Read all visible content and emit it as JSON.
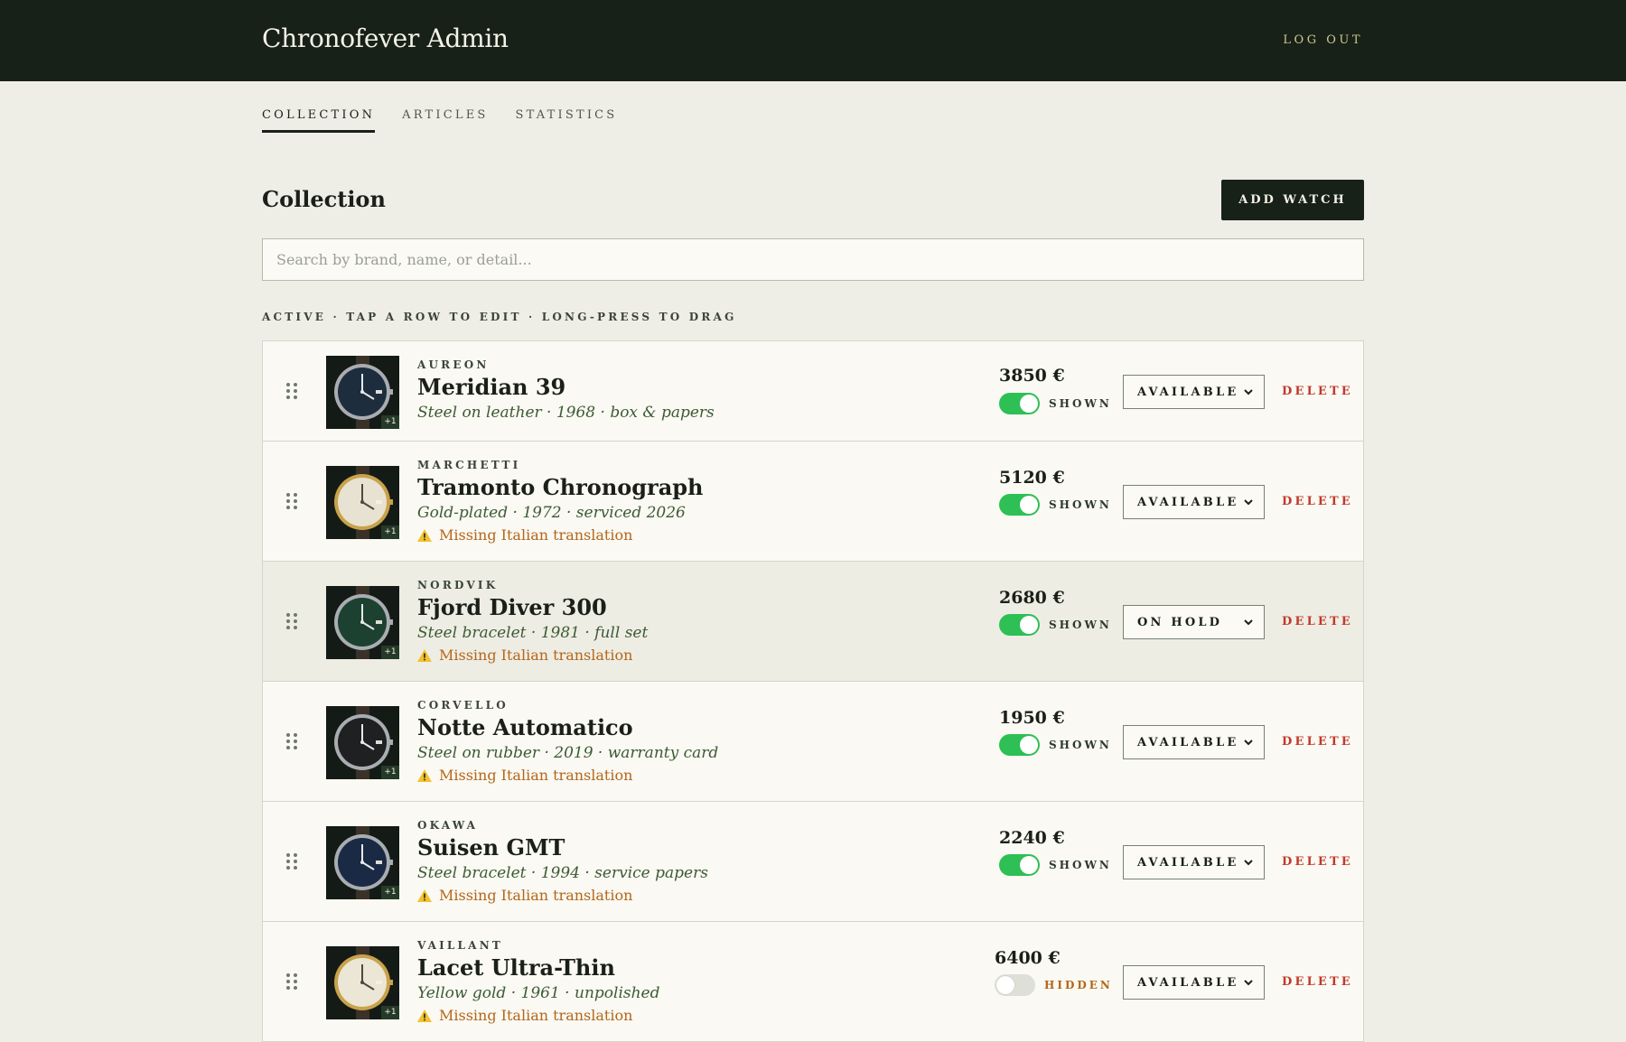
{
  "header": {
    "title": "Chronofever Admin",
    "logout_label": "LOG OUT"
  },
  "tabs": [
    {
      "label": "COLLECTION",
      "active": true
    },
    {
      "label": "ARTICLES",
      "active": false
    },
    {
      "label": "STATISTICS",
      "active": false
    }
  ],
  "main": {
    "title": "Collection",
    "add_label": "ADD WATCH",
    "search_placeholder": "Search by brand, name, or detail...",
    "hint": "ACTIVE · TAP A ROW TO EDIT · LONG-PRESS TO DRAG"
  },
  "colors": {
    "accent_dark": "#172117",
    "toggle_on": "#2ebf55",
    "warning": "#b4661a",
    "delete": "#c0392b"
  },
  "icons": {
    "drag": "drag-handle-icon",
    "warning": "warning-icon",
    "chevron": "chevron-down-icon",
    "watch": "watch-thumbnail-icon"
  },
  "watches": [
    {
      "brand": "AUREON",
      "name": "Meridian 39",
      "detail": "Steel on leather · 1968 · box & papers",
      "warning": "",
      "price": "3850 €",
      "visibility": "SHOWN",
      "visible": true,
      "status": "AVAILABLE",
      "delete_label": "DELETE",
      "thumb_badge": "+1",
      "dial": "#1e2d3e"
    },
    {
      "brand": "MARCHETTI",
      "name": "Tramonto Chronograph",
      "detail": "Gold-plated · 1972 · serviced 2026",
      "warning": "Missing Italian translation",
      "price": "5120 €",
      "visibility": "SHOWN",
      "visible": true,
      "status": "AVAILABLE",
      "delete_label": "DELETE",
      "thumb_badge": "+1",
      "dial": "#e8e2d2"
    },
    {
      "brand": "NORDVIK",
      "name": "Fjord Diver 300",
      "detail": "Steel bracelet · 1981 · full set",
      "warning": "Missing Italian translation",
      "price": "2680 €",
      "visibility": "SHOWN",
      "visible": true,
      "status": "ON HOLD",
      "delete_label": "DELETE",
      "thumb_badge": "+1",
      "dial": "#1d4130"
    },
    {
      "brand": "CORVELLO",
      "name": "Notte Automatico",
      "detail": "Steel on rubber · 2019 · warranty card",
      "warning": "Missing Italian translation",
      "price": "1950 €",
      "visibility": "SHOWN",
      "visible": true,
      "status": "AVAILABLE",
      "delete_label": "DELETE",
      "thumb_badge": "+1",
      "dial": "#1f2022"
    },
    {
      "brand": "OKAWA",
      "name": "Suisen GMT",
      "detail": "Steel bracelet · 1994 · service papers",
      "warning": "Missing Italian translation",
      "price": "2240 €",
      "visibility": "SHOWN",
      "visible": true,
      "status": "AVAILABLE",
      "delete_label": "DELETE",
      "thumb_badge": "+1",
      "dial": "#1b2a44"
    },
    {
      "brand": "VAILLANT",
      "name": "Lacet Ultra-Thin",
      "detail": "Yellow gold · 1961 · unpolished",
      "warning": "Missing Italian translation",
      "price": "6400 €",
      "visibility": "HIDDEN",
      "visible": false,
      "status": "AVAILABLE",
      "delete_label": "DELETE",
      "thumb_badge": "+1",
      "dial": "#ebe6d6"
    }
  ]
}
